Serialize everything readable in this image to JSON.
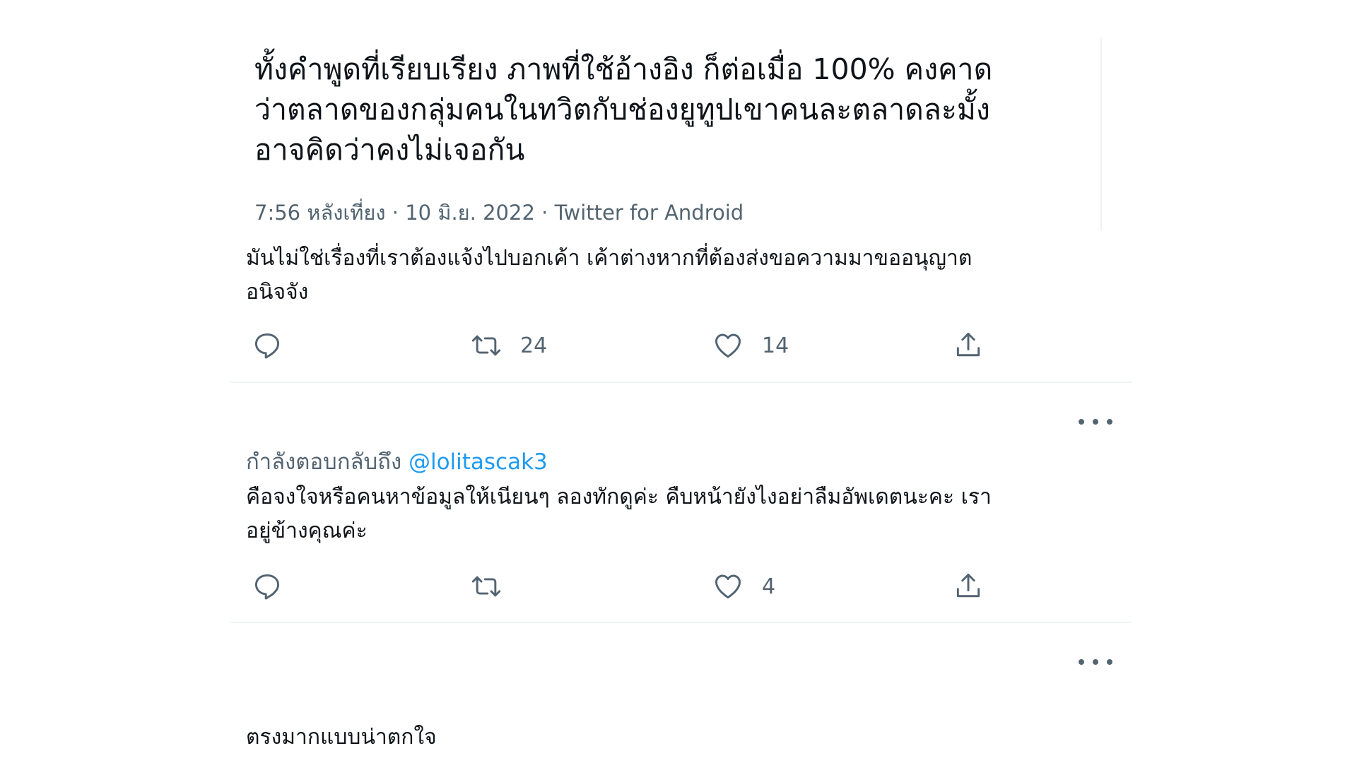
{
  "main_tweet": {
    "text_lines": [
      "ทั้งคำพูดที่เรียบเรียง ภาพที่ใช้อ้างอิง ก็ต่อเมื่อ 100%  คงคาด",
      "ว่าตลาดของกลุ่มคนในทวิตกับช่องยูทูปเขาคนละตลาดละมั้ง",
      "อาจคิดว่าคงไม่เจอกัน"
    ],
    "meta": "7:56 หลังเที่ยง · 10 มิ.ย. 2022 · Twitter for Android"
  },
  "replies": [
    {
      "text_lines": [
        "มันไม่ใช่เรื่องที่เราต้องแจ้งไปบอกเค้า เค้าต่างหากที่ต้องส่งขอความมาขออนุญาต",
        "อนิจจัง"
      ],
      "retweet_count": "24",
      "like_count": "14"
    },
    {
      "replying_prefix": "กำลังตอบกลับถึง",
      "replying_handle": "@lolitascak3",
      "text_lines": [
        "คือจงใจหรือคนหาข้อมูลให้เนียนๆ ลองทักดูค่ะ คืบหน้ายังไงอย่าลืมอัพเดตนะคะ เรา",
        "อยู่ข้างคุณค่ะ"
      ],
      "retweet_count": "",
      "like_count": "4"
    },
    {
      "text_lines": [
        "ตรงมากแบบน่าตกใจ"
      ]
    }
  ],
  "icons": {
    "reply": "reply-icon",
    "retweet": "retweet-icon",
    "like": "heart-icon",
    "share": "share-icon",
    "more": "more-icon"
  },
  "colors": {
    "text": "#0f1419",
    "secondary": "#536471",
    "link": "#1d9bf0",
    "divider": "#eff3f4"
  }
}
